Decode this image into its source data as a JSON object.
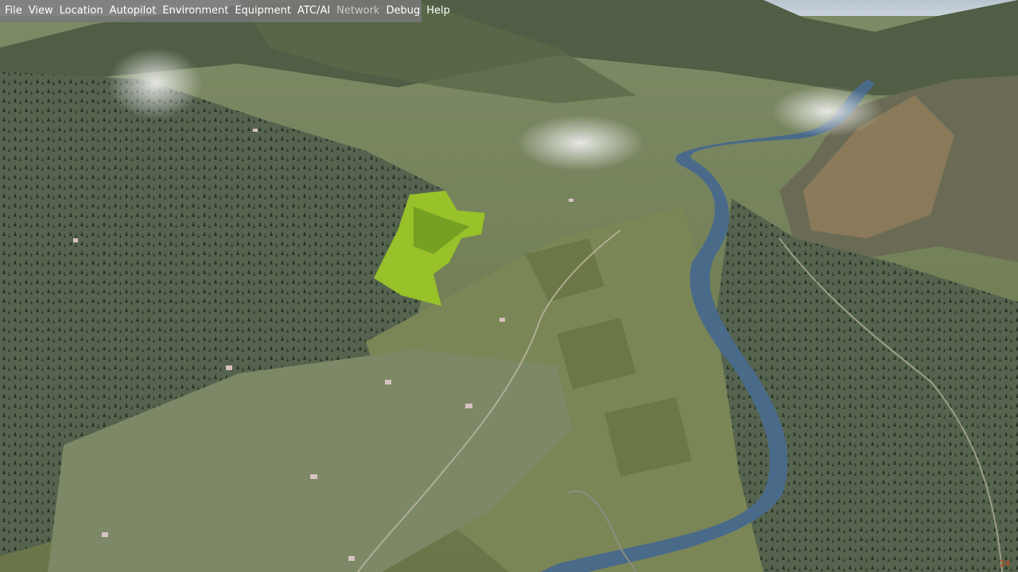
{
  "menu": {
    "items": [
      {
        "label": "File",
        "enabled": true
      },
      {
        "label": "View",
        "enabled": true
      },
      {
        "label": "Location",
        "enabled": true
      },
      {
        "label": "Autopilot",
        "enabled": true
      },
      {
        "label": "Environment",
        "enabled": true
      },
      {
        "label": "Equipment",
        "enabled": true
      },
      {
        "label": "ATC/AI",
        "enabled": true
      },
      {
        "label": "Network",
        "enabled": false
      },
      {
        "label": "Debug",
        "enabled": true
      },
      {
        "label": "Help",
        "enabled": true
      }
    ]
  },
  "hud": {
    "frame_rate": "24"
  },
  "colors": {
    "sky": "#c9d2da",
    "river": "#4a6a8a",
    "valley": "#6e7a4c",
    "forest": "#4a5a44",
    "field_highlight": "#9cc02a",
    "menubar": "#787878",
    "fps_text": "#d0451b"
  }
}
